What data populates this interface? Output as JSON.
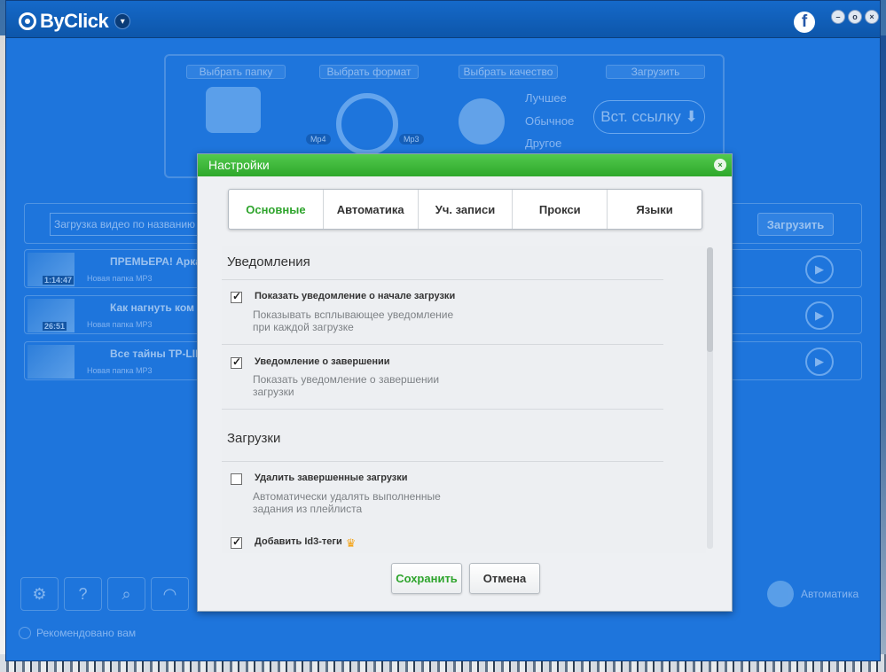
{
  "app": {
    "name": "ByClick"
  },
  "background": {
    "steps": [
      "Выбрать папку",
      "Выбрать формат",
      "Выбрать качество",
      "Загрузить"
    ],
    "format_tags": [
      "Mp4",
      "Mp3"
    ],
    "quality_options": [
      "Лучшее",
      "Обычное",
      "Другое"
    ],
    "paste_button": "Вст. ссылку",
    "search_placeholder": "Загрузка видео по названию",
    "load_button": "Загрузить",
    "downloads": [
      {
        "title": "ПРЕМЬЕРА! Арка",
        "duration": "1:14:47",
        "folder": "Новая папка МР3"
      },
      {
        "title": "Как нагнуть ком",
        "duration": "26:51",
        "folder": "Новая папка МР3"
      },
      {
        "title": "Все тайны TP-LIN",
        "duration": "",
        "folder": "Новая папка МР3"
      }
    ],
    "automation_label": "Автоматика",
    "recommended": "Рекомендовано вам"
  },
  "dialog": {
    "title": "Настройки",
    "tabs": [
      "Основные",
      "Автоматика",
      "Уч. записи",
      "Прокси",
      "Языки"
    ],
    "active_tab": "Основные",
    "sections": [
      {
        "heading": "Уведомления",
        "options": [
          {
            "label": "Показать уведомление о начале загрузки",
            "checked": true,
            "desc": "Показывать всплывающее уведомление при каждой загрузке"
          },
          {
            "label": "Уведомление о завершении",
            "checked": true,
            "desc": "Показать уведомление о завершении загрузки"
          }
        ]
      },
      {
        "heading": "Загрузки",
        "options": [
          {
            "label": "Удалить завершенные загрузки",
            "checked": false,
            "desc": "Автоматически удалять выполненные задания из плейлиста"
          },
          {
            "label": "Добавить Id3-теги",
            "checked": true,
            "desc": ""
          }
        ]
      }
    ],
    "save_button": "Сохранить",
    "cancel_button": "Отмена"
  },
  "colors": {
    "app_blue": "#1e75dc",
    "dialog_green": "#2ea82b",
    "crown": "#f4a214"
  }
}
